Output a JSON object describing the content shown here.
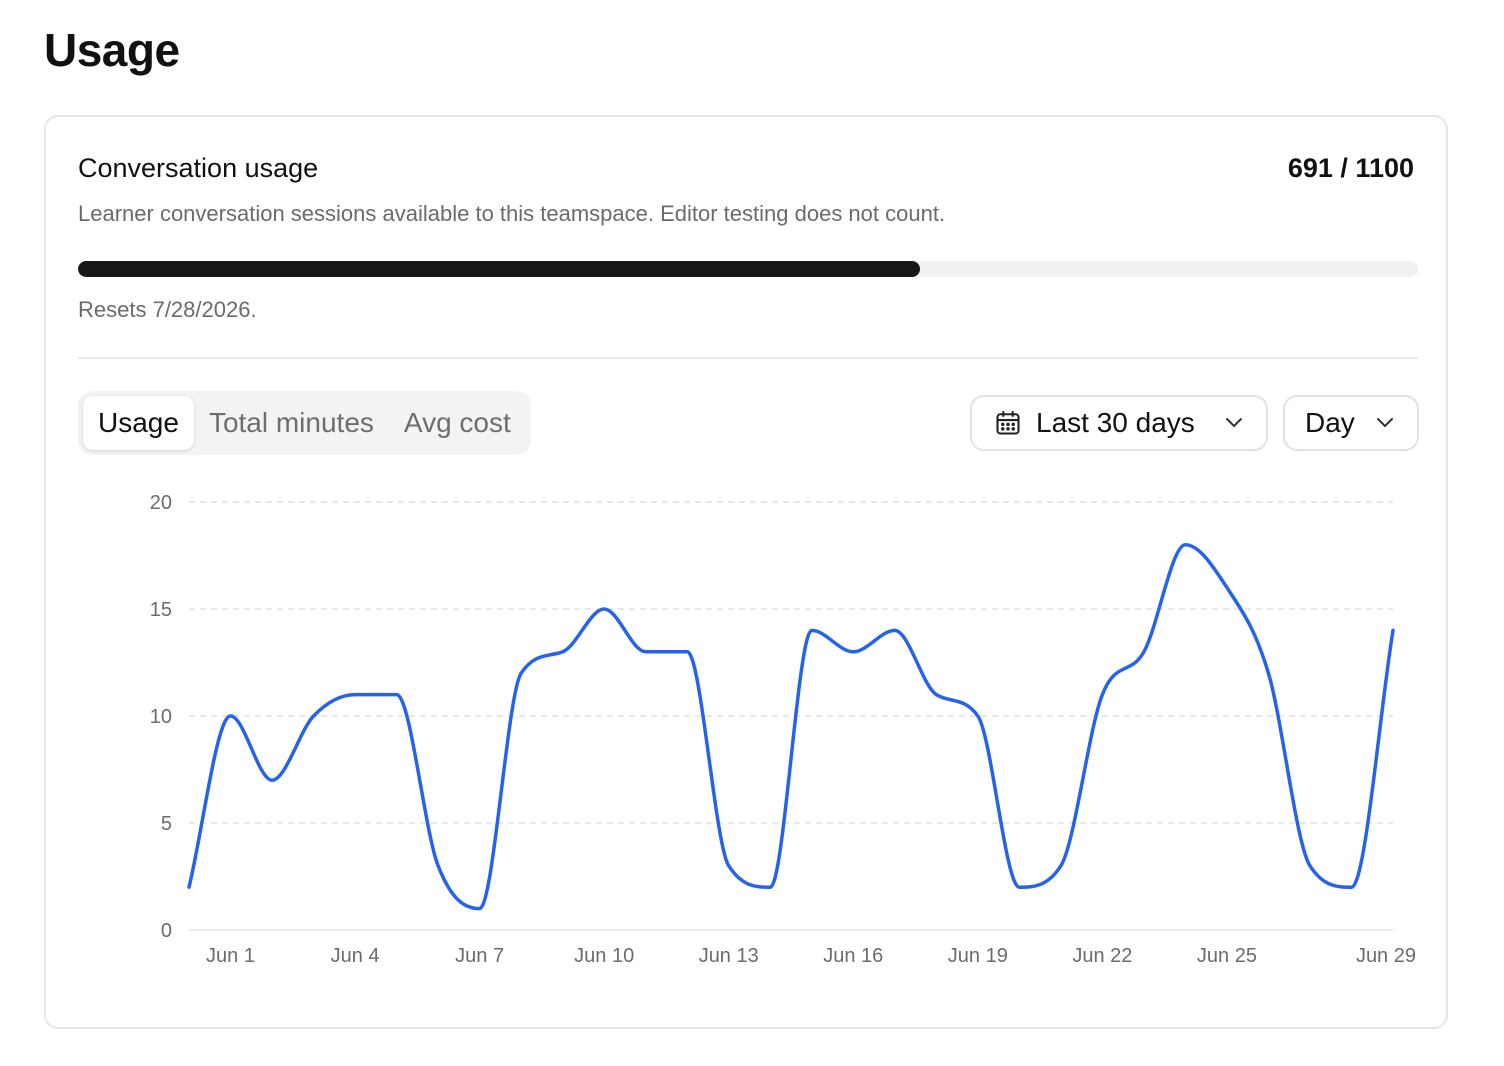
{
  "page": {
    "title": "Usage"
  },
  "usage_card": {
    "title": "Conversation usage",
    "count": "691 / 1100",
    "used": 691,
    "limit": 1100,
    "description": "Learner conversation sessions available to this teamspace. Editor testing does not count.",
    "reset": "Resets 7/28/2026.",
    "bar_color": "#171717",
    "track_color": "#f1f1f1"
  },
  "tabs": [
    {
      "label": "Usage",
      "active": true
    },
    {
      "label": "Total minutes",
      "active": false
    },
    {
      "label": "Avg cost",
      "active": false
    }
  ],
  "filters": {
    "range": {
      "label": "Last 30 days",
      "icon": "calendar-icon"
    },
    "granularity": {
      "label": "Day"
    }
  },
  "chart_data": {
    "type": "line",
    "x": [
      "May 31",
      "Jun 1",
      "Jun 2",
      "Jun 3",
      "Jun 4",
      "Jun 5",
      "Jun 6",
      "Jun 7",
      "Jun 8",
      "Jun 9",
      "Jun 10",
      "Jun 11",
      "Jun 12",
      "Jun 13",
      "Jun 14",
      "Jun 15",
      "Jun 16",
      "Jun 17",
      "Jun 18",
      "Jun 19",
      "Jun 20",
      "Jun 21",
      "Jun 22",
      "Jun 23",
      "Jun 24",
      "Jun 25",
      "Jun 26",
      "Jun 27",
      "Jun 28",
      "Jun 29"
    ],
    "values": [
      2,
      10,
      7,
      10,
      11,
      11,
      3,
      1,
      12,
      13,
      15,
      13,
      13,
      3,
      2,
      14,
      13,
      14,
      11,
      10,
      2,
      3,
      11,
      13,
      18,
      16,
      12,
      3,
      2,
      14
    ],
    "x_tick_labels": [
      "Jun 1",
      "Jun 4",
      "Jun 7",
      "Jun 10",
      "Jun 13",
      "Jun 16",
      "Jun 19",
      "Jun 22",
      "Jun 25",
      "Jun 29"
    ],
    "y_ticks": [
      0,
      5,
      10,
      15,
      20
    ],
    "ylim": [
      0,
      20
    ],
    "line_color": "#2563eb",
    "grid": true,
    "title": "",
    "xlabel": "",
    "ylabel": ""
  }
}
